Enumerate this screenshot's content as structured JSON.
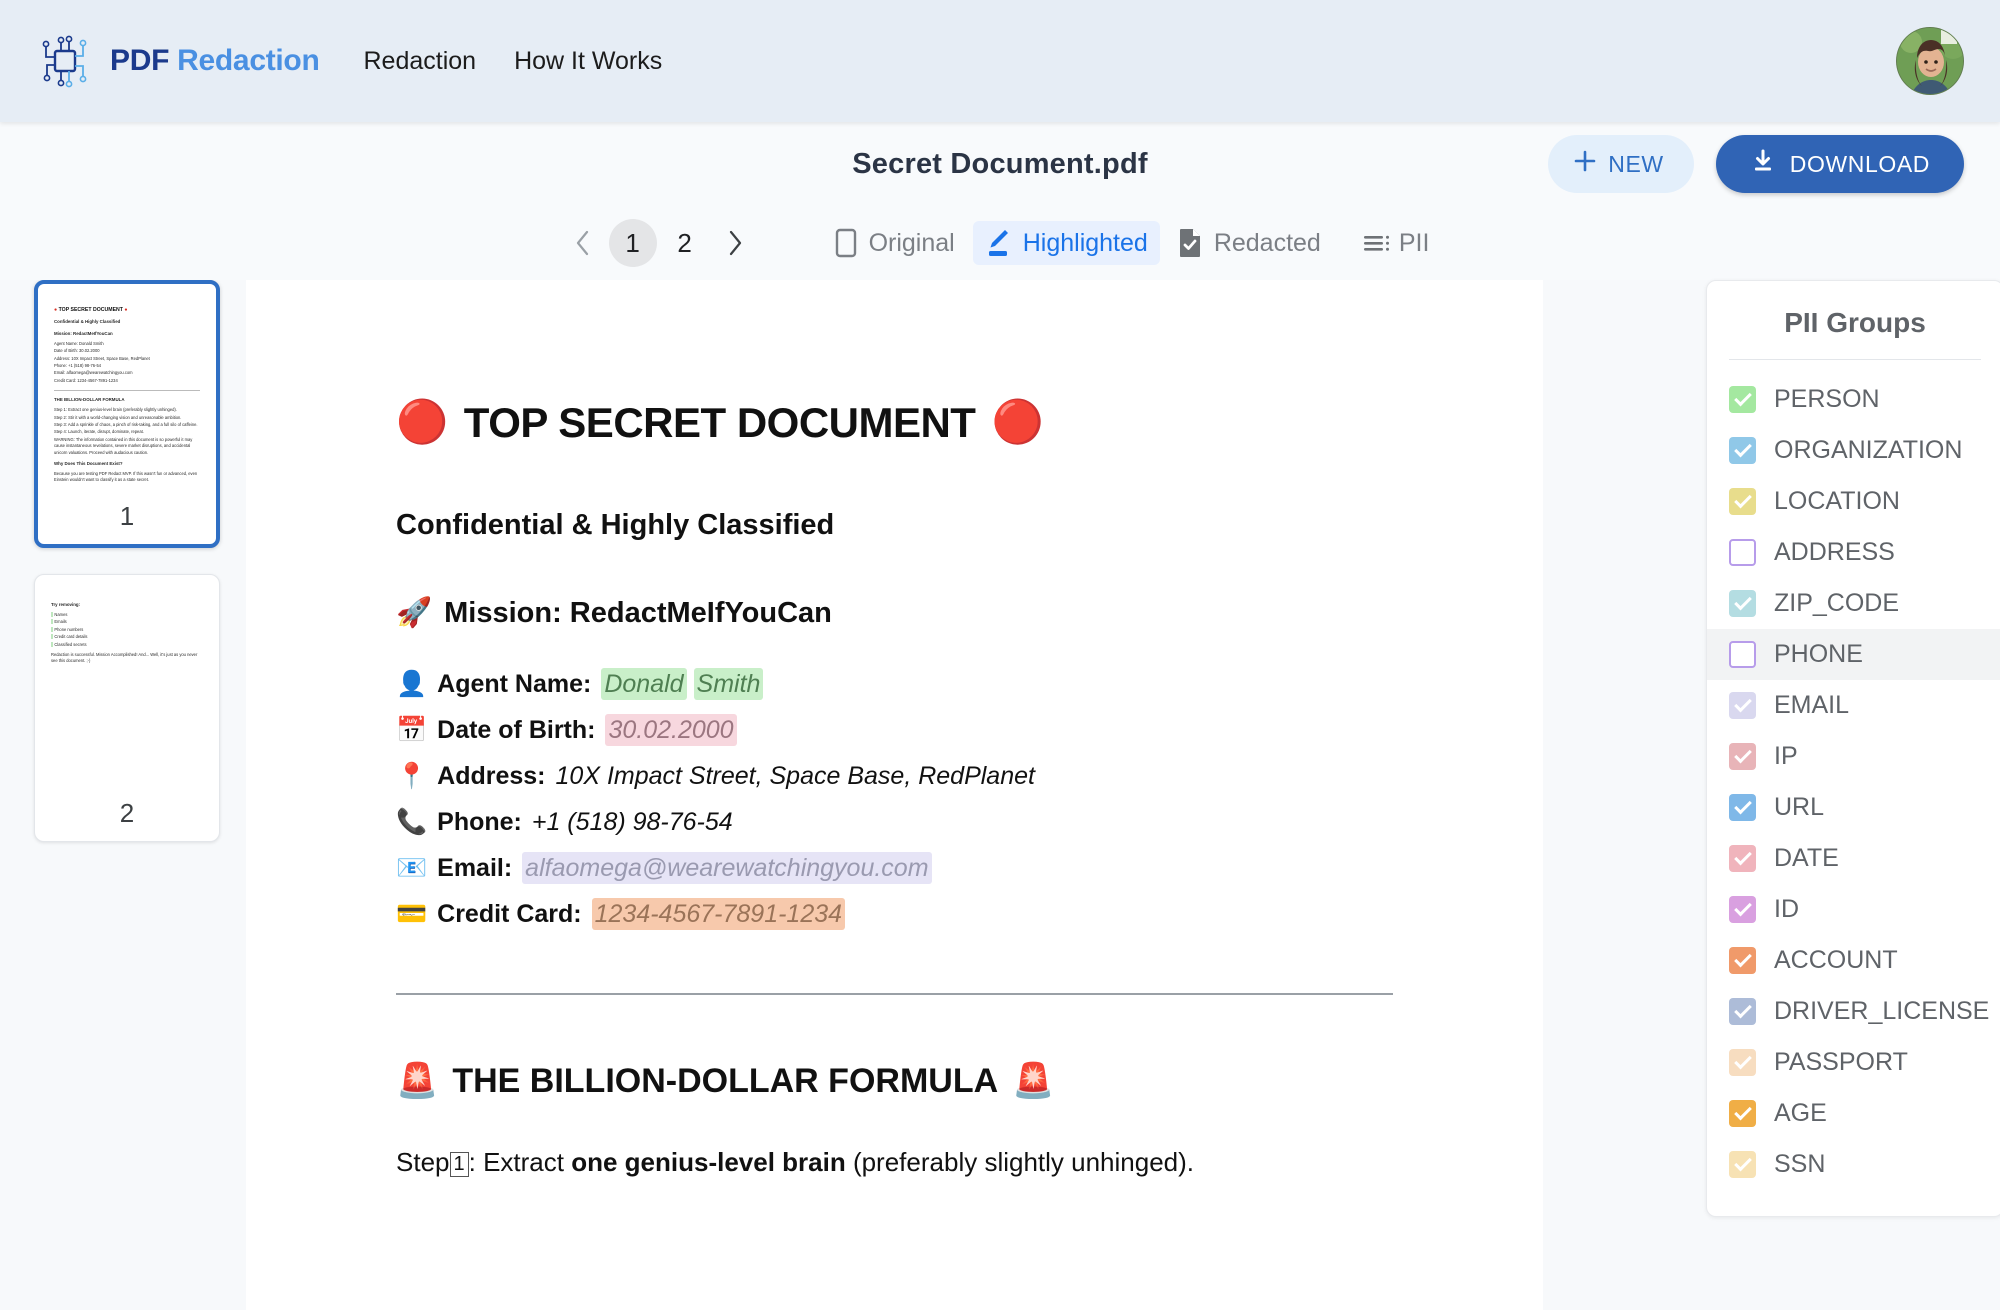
{
  "navbar": {
    "brand_word1": "PDF",
    "brand_word2": "Redaction",
    "logo_icon": "circuit-chip-icon",
    "links": [
      {
        "label": "Redaction",
        "name": "nav-link-redaction"
      },
      {
        "label": "How It Works",
        "name": "nav-link-how-it-works"
      }
    ],
    "avatar_icon": "user-avatar"
  },
  "subheader": {
    "document_title": "Secret Document.pdf",
    "new_label": "NEW",
    "new_icon": "plus-icon",
    "download_label": "DOWNLOAD",
    "download_icon": "download-icon"
  },
  "toolbar": {
    "prev_icon": "chevron-left-icon",
    "next_icon": "chevron-right-icon",
    "pages": [
      "1",
      "2"
    ],
    "active_page": "1",
    "modes": [
      {
        "label": "Original",
        "icon": "document-outline-icon",
        "active": false
      },
      {
        "label": "Highlighted",
        "icon": "pen-highlight-icon",
        "active": true
      },
      {
        "label": "Redacted",
        "icon": "document-check-icon",
        "active": false
      }
    ],
    "pii_toggle_label": "PII",
    "pii_toggle_icon": "list-lines-icon"
  },
  "thumbnails": [
    {
      "page_label": "1",
      "selected": true
    },
    {
      "page_label": "2",
      "selected": false
    }
  ],
  "thumbnail_preview": {
    "page1": {
      "h1": "TOP SECRET DOCUMENT",
      "h2": "Confidential & Highly Classified",
      "mission": "Mission: RedactMeIfYouCan",
      "rows": [
        "Agent Name: Donald Smith",
        "Date of Birth: 30.02.2000",
        "Address: 10X Impact Street, Space Base, RedPlanet",
        "Phone: +1 (518) 98-76-54",
        "Email: alfaomega@wearewatchingyou.com",
        "Credit Card: 1234-4567-7891-1234"
      ],
      "section": "THE BILLION-DOLLAR FORMULA",
      "steps": [
        "Step 1: Extract one genius-level brain (preferably slightly unhinged).",
        "Step 2: Stir it with a world-changing vision and unreasonable ambition.",
        "Step 3: Add a sprinkle of chaos, a pinch of risk-taking, and a full silo of caffeine.",
        "Step 4: Launch, iterate, disrupt, dominate, repeat."
      ],
      "warning": "WARNING: The information contained in this document is so powerful it may cause instantaneous revelations, severe market disruptions, and accidental unicorn valuations. Proceed with audacious caution.",
      "why": "Why Does This Document Exist?",
      "why_text": "Because you are testing PDF Redact MVP. If this wasn't fun or advanced, even Einstein wouldn't want to classify it as a state secret."
    },
    "page2": {
      "h1": "Try removing:",
      "items": [
        "Names",
        "Emails",
        "Phone numbers",
        "Credit card details",
        "Classified secrets"
      ],
      "closing": "Redaction is successful. Mission Accomplished! And... Well, it's just as you never see this document. ;-)"
    }
  },
  "document": {
    "heading": "TOP SECRET DOCUMENT",
    "heading_emoji_left": "🔴",
    "heading_emoji_right": "🔴",
    "subheading": "Confidential & Highly Classified",
    "mission_emoji": "🚀",
    "mission": "Mission: RedactMeIfYouCan",
    "fields": [
      {
        "icon": "👤",
        "icon_name": "person-icon",
        "label": "Agent Name:",
        "value_parts": [
          {
            "text": "Donald",
            "style": "person"
          },
          {
            "text": "Smith",
            "style": "person"
          }
        ]
      },
      {
        "icon": "📅",
        "icon_name": "calendar-icon",
        "label": "Date of Birth:",
        "value_parts": [
          {
            "text": "30.02.2000",
            "style": "date"
          }
        ]
      },
      {
        "icon": "📍",
        "icon_name": "location-pin-icon",
        "label": "Address:",
        "value_parts": [
          {
            "text": "10X Impact Street, Space Base, RedPlanet",
            "style": "plain"
          }
        ]
      },
      {
        "icon": "📞",
        "icon_name": "phone-icon",
        "label": "Phone:",
        "value_parts": [
          {
            "text": "+1 (518) 98-76-54",
            "style": "plain"
          }
        ]
      },
      {
        "icon": "📧",
        "icon_name": "email-icon",
        "label": "Email:",
        "value_parts": [
          {
            "text": "alfaomega@wearewatchingyou.com",
            "style": "email"
          }
        ]
      },
      {
        "icon": "💳",
        "icon_name": "credit-card-icon",
        "label": "Credit Card:",
        "value_parts": [
          {
            "text": "1234-4567-7891-1234",
            "style": "card"
          }
        ]
      }
    ],
    "formula_emoji": "🚨",
    "formula_heading": "THE BILLION-DOLLAR FORMULA",
    "step_prefix": "Step",
    "step_number": "1",
    "step_after_number": ": Extract ",
    "step_bold": "one genius-level brain",
    "step_tail": " (preferably slightly unhinged)."
  },
  "pii_panel": {
    "title": "PII Groups",
    "groups": [
      {
        "label": "PERSON",
        "checked": true,
        "color": "#a4e8a0",
        "hover": false
      },
      {
        "label": "ORGANIZATION",
        "checked": true,
        "color": "#90c8e8",
        "hover": false
      },
      {
        "label": "LOCATION",
        "checked": true,
        "color": "#e8dd8c",
        "hover": false
      },
      {
        "label": "ADDRESS",
        "checked": false,
        "color": "#ffffff",
        "hover": false
      },
      {
        "label": "ZIP_CODE",
        "checked": true,
        "color": "#b4dde2",
        "hover": false
      },
      {
        "label": "PHONE",
        "checked": false,
        "color": "#ffffff",
        "hover": true
      },
      {
        "label": "EMAIL",
        "checked": true,
        "color": "#d9d8ef",
        "hover": false
      },
      {
        "label": "IP",
        "checked": true,
        "color": "#e8b4b8",
        "hover": false
      },
      {
        "label": "URL",
        "checked": true,
        "color": "#7fb8e8",
        "hover": false
      },
      {
        "label": "DATE",
        "checked": true,
        "color": "#f0b4bc",
        "hover": false
      },
      {
        "label": "ID",
        "checked": true,
        "color": "#d9a0e0",
        "hover": false
      },
      {
        "label": "ACCOUNT",
        "checked": true,
        "color": "#f09a6a",
        "hover": false
      },
      {
        "label": "DRIVER_LICENSE",
        "checked": true,
        "color": "#adbcd8",
        "hover": false
      },
      {
        "label": "PASSPORT",
        "checked": true,
        "color": "#f7ddc0",
        "hover": false
      },
      {
        "label": "AGE",
        "checked": true,
        "color": "#f0ae46",
        "hover": false
      },
      {
        "label": "SSN",
        "checked": true,
        "color": "#f7e2b4",
        "hover": false
      }
    ]
  },
  "colors": {
    "brand_dark": "#1b3a8c",
    "brand_light": "#4a90e2",
    "accent": "#3064b5",
    "nav_bg": "#e6edf5",
    "page_bg": "#f7f9fb",
    "active_mode": "#1a73e8"
  }
}
